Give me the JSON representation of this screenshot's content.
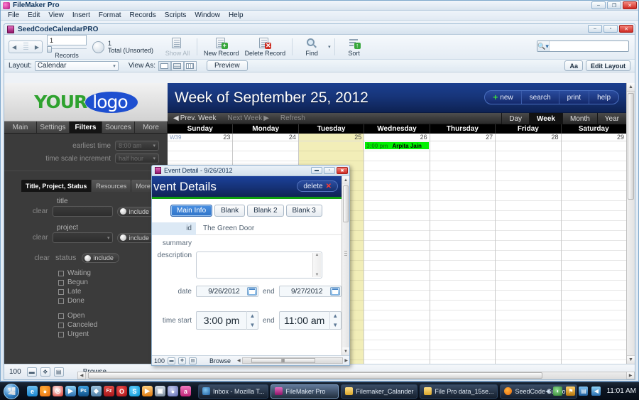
{
  "app": {
    "title": "FileMaker Pro",
    "menus": [
      "File",
      "Edit",
      "View",
      "Insert",
      "Format",
      "Records",
      "Scripts",
      "Window",
      "Help"
    ],
    "window_controls": {
      "minimize": "–",
      "restore": "❐",
      "close": "✕"
    }
  },
  "document": {
    "title": "SeedCodeCalendarPRO",
    "window_controls": {
      "minimize": "–",
      "maximize": "▫",
      "close": "✕"
    }
  },
  "toolbar": {
    "record_number": "1",
    "records_label": "Records",
    "total_number": "1",
    "total_label": "Total (Unsorted)",
    "show_all_label": "Show All",
    "new_record_label": "New Record",
    "delete_record_label": "Delete Record",
    "find_label": "Find",
    "sort_label": "Sort",
    "search_placeholder": ""
  },
  "layout_bar": {
    "layout_label": "Layout:",
    "layout_value": "Calendar",
    "view_as_label": "View As:",
    "preview_label": "Preview",
    "text_format_label": "Aa",
    "edit_layout_label": "Edit Layout"
  },
  "sidebar": {
    "logo": {
      "part1": "YOUR",
      "part2": "logo"
    },
    "tabs": [
      {
        "label": "Main",
        "active": false
      },
      {
        "label": "Settings",
        "active": false
      },
      {
        "label": "Filters",
        "active": true
      },
      {
        "label": "Sources",
        "active": false
      },
      {
        "label": "More",
        "active": false
      }
    ],
    "settings": [
      {
        "label": "earliest time",
        "value": "8:00 am"
      },
      {
        "label": "time scale increment",
        "value": "half hour"
      }
    ],
    "filter_tabs": [
      {
        "label": "Title, Project, Status",
        "active": true
      },
      {
        "label": "Resources",
        "active": false
      },
      {
        "label": "More",
        "active": false
      }
    ],
    "clear_label": "clear",
    "include_label": "include",
    "title_field": {
      "label": "title",
      "value": ""
    },
    "project_field": {
      "label": "project",
      "value": ""
    },
    "status_label": "status",
    "status_group_1": [
      "Waiting",
      "Begun",
      "Late",
      "Done"
    ],
    "status_group_2": [
      "Open",
      "Canceled",
      "Urgent"
    ]
  },
  "calendar": {
    "title": "Week of September 25, 2012",
    "header_buttons": [
      "new",
      "search",
      "print",
      "help"
    ],
    "nav_links": [
      "Prev. Week",
      "Next Week",
      "Refresh"
    ],
    "view_buttons": [
      {
        "label": "Day",
        "active": false
      },
      {
        "label": "Week",
        "active": true
      },
      {
        "label": "Month",
        "active": false
      },
      {
        "label": "Year",
        "active": false
      }
    ],
    "weekday_headers": [
      "Sunday",
      "Monday",
      "Tuesday",
      "Wednesday",
      "Thursday",
      "Friday",
      "Saturday"
    ],
    "week_number": "W39",
    "days": [
      {
        "date": "23",
        "today": false
      },
      {
        "date": "24",
        "today": false
      },
      {
        "date": "25",
        "today": true
      },
      {
        "date": "26",
        "today": false
      },
      {
        "date": "27",
        "today": false
      },
      {
        "date": "28",
        "today": false
      },
      {
        "date": "29",
        "today": false
      }
    ],
    "event": {
      "time": "3:00 pm",
      "title": "Arpita Jain",
      "color": "#00f000",
      "day_index": 3
    }
  },
  "status_bar": {
    "zoom": "100",
    "mode": "Browse"
  },
  "dialog": {
    "window_title": "Event Detail  -  9/26/2012",
    "banner_title": "vent Details",
    "delete_label": "delete",
    "tabs": [
      {
        "label": "Main Info",
        "active": true
      },
      {
        "label": "Blank",
        "active": false
      },
      {
        "label": "Blank 2",
        "active": false
      },
      {
        "label": "Blank 3",
        "active": false
      }
    ],
    "id_label": "id",
    "id_value": "The Green Door",
    "summary_label": "summary",
    "summary_value": "",
    "description_label": "description",
    "description_value": "",
    "date_label": "date",
    "date_value": "9/26/2012",
    "date_end_label": "end",
    "date_end_value": "9/27/2012",
    "time_label": "time start",
    "time_value": "3:00 pm",
    "time_end_label": "end",
    "time_end_value": "11:00 am",
    "zoom": "100",
    "mode": "Browse"
  },
  "taskbar": {
    "quick_launch": [
      {
        "name": "internet-explorer-icon",
        "glyph": "e",
        "color": "#1a86d0"
      },
      {
        "name": "firefox-icon",
        "glyph": "●",
        "color": "#e8690b"
      },
      {
        "name": "chrome-icon",
        "glyph": "◉",
        "color": "#d93025"
      },
      {
        "name": "media-player-icon",
        "glyph": "▶",
        "color": "#4a90e2"
      },
      {
        "name": "photoshop-icon",
        "glyph": "Ps",
        "color": "#1f6fb0"
      },
      {
        "name": "acrobat-icon",
        "glyph": "◆",
        "color": "#4f7fa8"
      },
      {
        "name": "filezilla-icon",
        "glyph": "Fz",
        "color": "#bf2024"
      },
      {
        "name": "opera-icon",
        "glyph": "O",
        "color": "#cc0f16"
      },
      {
        "name": "skype-icon",
        "glyph": "S",
        "color": "#00aff0"
      },
      {
        "name": "vlc-icon",
        "glyph": "▶",
        "color": "#f48b20"
      },
      {
        "name": "package-icon",
        "glyph": "▣",
        "color": "#9aa8b8"
      },
      {
        "name": "disc-icon",
        "glyph": "●",
        "color": "#7a86c8"
      },
      {
        "name": "app-icon",
        "glyph": "a",
        "color": "#d43f8d"
      }
    ],
    "tasks": [
      {
        "label": "Inbox - Mozilla T...",
        "icon_color": "#3b7cc4",
        "active": false
      },
      {
        "label": "FileMaker Pro",
        "icon_color": "#c0298f",
        "active": true
      },
      {
        "label": "Filemaker_Calander",
        "icon_color": "#e8c55a",
        "active": false
      },
      {
        "label": "File Pro data_15se...",
        "icon_color": "#e8c55a",
        "active": false
      },
      {
        "label": "SeedCode Suppor...",
        "icon_color": "#e8690b",
        "active": false
      }
    ],
    "tray": [
      {
        "name": "network-icon",
        "glyph": "◔",
        "color": "#3a7f3a"
      },
      {
        "name": "antivirus-icon",
        "glyph": "⚑",
        "color": "#cc8a1a"
      },
      {
        "name": "connection-icon",
        "glyph": "▤",
        "color": "#2f6fa8"
      },
      {
        "name": "volume-icon",
        "glyph": "◀",
        "color": "#2b6fb0"
      }
    ],
    "clock": "11:01 AM"
  }
}
